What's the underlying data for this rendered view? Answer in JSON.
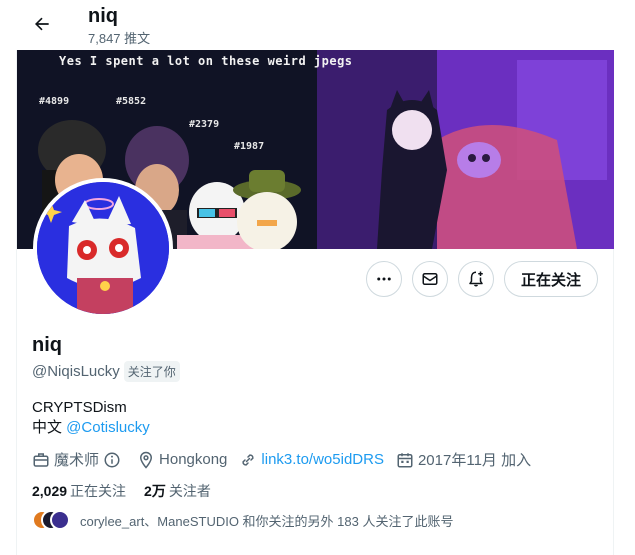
{
  "header": {
    "title": "niq",
    "tweet_count": "7,847 推文"
  },
  "banner": {
    "caption": "Yes I spent a lot on these weird jpegs",
    "tags": [
      "#4899",
      "#5852",
      "#2379",
      "#1987"
    ]
  },
  "actions": {
    "more_icon": "more-icon",
    "message_icon": "mail-icon",
    "notify_icon": "bell-plus-icon",
    "follow_label": "正在关注"
  },
  "profile": {
    "name": "niq",
    "handle": "@NiqisLucky",
    "follows_you": "关注了你",
    "bio_line1": "CRYPTSDism",
    "bio_line2_prefix": "中文 ",
    "bio_line2_mention": "@Cotislucky"
  },
  "meta": {
    "job": "魔术师",
    "location": "Hongkong",
    "link": "link3.to/wo5idDRS",
    "joined": "2017年11月 加入"
  },
  "stats": {
    "following_count": "2,029",
    "following_label": "正在关注",
    "followers_count": "2万",
    "followers_label": "关注者"
  },
  "mutual": {
    "text": "corylee_art、ManeSTUDIO 和你关注的另外 183 人关注了此账号"
  },
  "colors": {
    "link": "#1d9bf0",
    "secondary_text": "#536471",
    "avatar_bg": "#2a2fe0"
  }
}
